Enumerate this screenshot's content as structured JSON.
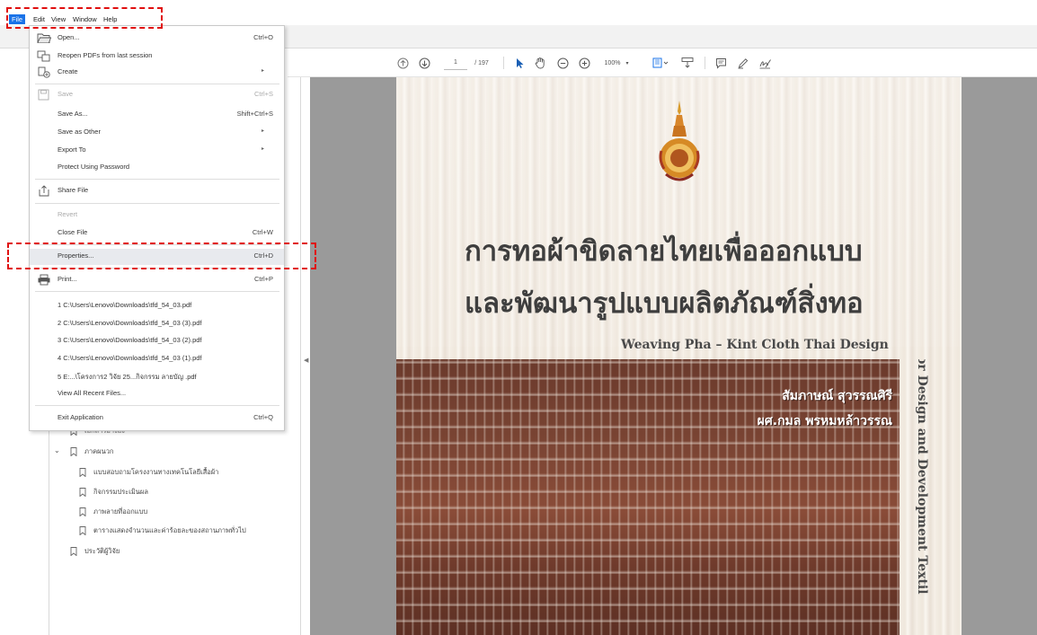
{
  "menubar": {
    "items": [
      "File",
      "Edit",
      "View",
      "Window",
      "Help"
    ]
  },
  "toolbar": {
    "page_current": "1",
    "page_total": "/ 197",
    "zoom": "100%"
  },
  "file_menu": {
    "open": {
      "label": "Open...",
      "shortcut": "Ctrl+O"
    },
    "reopen": {
      "label": "Reopen PDFs from last session"
    },
    "create": {
      "label": "Create"
    },
    "save": {
      "label": "Save",
      "shortcut": "Ctrl+S"
    },
    "save_as": {
      "label": "Save As...",
      "shortcut": "Shift+Ctrl+S"
    },
    "save_as_other": {
      "label": "Save as Other"
    },
    "export_to": {
      "label": "Export To"
    },
    "protect": {
      "label": "Protect Using Password"
    },
    "share": {
      "label": "Share File"
    },
    "revert": {
      "label": "Revert"
    },
    "close": {
      "label": "Close File",
      "shortcut": "Ctrl+W"
    },
    "properties": {
      "label": "Properties...",
      "shortcut": "Ctrl+D"
    },
    "print": {
      "label": "Print...",
      "shortcut": "Ctrl+P"
    },
    "recent": [
      "1 C:\\Users\\Lenovo\\Downloads\\tfd_54_03.pdf",
      "2 C:\\Users\\Lenovo\\Downloads\\tfd_54_03 (3).pdf",
      "3 C:\\Users\\Lenovo\\Downloads\\tfd_54_03 (2).pdf",
      "4 C:\\Users\\Lenovo\\Downloads\\tfd_54_03 (1).pdf",
      "5 E:...\\โครงการ2 วิจัย 25...กิจกรรม ลายบัญ .pdf"
    ],
    "view_all_recent": {
      "label": "View All Recent Files..."
    },
    "exit": {
      "label": "Exit Application",
      "shortcut": "Ctrl+Q"
    }
  },
  "bookmarks": {
    "partial_item": "เอกสารอ้างอิง",
    "appendix": "ภาคผนวก",
    "children": [
      "แบบสอบถามโครงงานทางเทคโนโลยีเสื้อผ้า",
      "กิจกรรมประเมินผล",
      "ภาพลายที่ออกแบบ",
      "ตารางแสดงจำนวนและค่าร้อยละของสถานภาพทั่วไป"
    ],
    "researcher": "ประวัติผู้วิจัย"
  },
  "document": {
    "title_line1": "การทอผ้าขิดลายไทยเพื่อออกแบบ",
    "title_line2": "และพัฒนารูปแบบผลิตภัณฑ์สิ่งทอ",
    "subtitle_en": "Weaving Pha – Kint Cloth Thai Design",
    "vertical_en": "for Design and Development Textil",
    "author1": "สัมภาษณ์ สุวรรณศิรี",
    "author2": "ผศ.กมล พรหมหล้าวรรณ"
  },
  "colors": {
    "highlight": "#e01010",
    "menu_active": "#1a73e8",
    "page_gray": "#9a9a9a"
  }
}
